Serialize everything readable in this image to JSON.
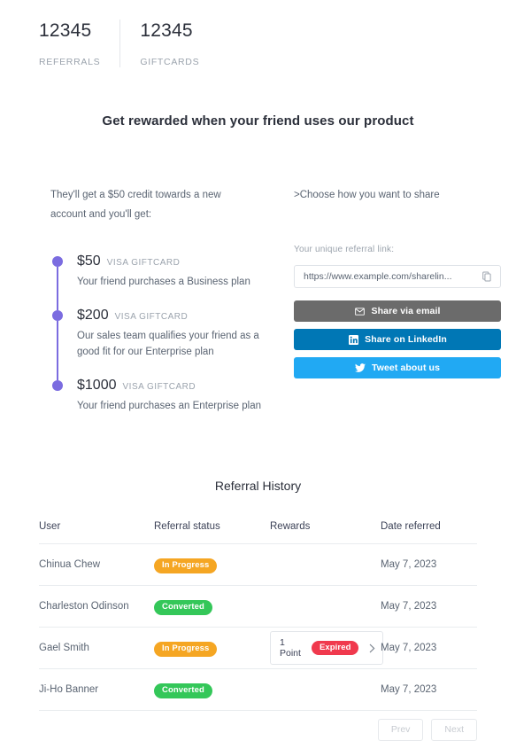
{
  "header": {
    "stats": [
      {
        "value": "12345",
        "label": "REFERRALS",
        "name": "referrals"
      },
      {
        "value": "12345",
        "label": "GIFTCARDS",
        "name": "giftcards"
      }
    ]
  },
  "hero": {
    "title": "Get rewarded when your friend uses our product",
    "intro": "They'll get a $50 credit towards a new account and you'll get:"
  },
  "timeline": {
    "items": [
      {
        "amount": "$50",
        "kind": "VISA GIFTCARD",
        "desc": "Your friend purchases a Business plan"
      },
      {
        "amount": "$200",
        "kind": "VISA GIFTCARD",
        "desc": "Our sales team qualifies your friend as a good fit for our Enterprise plan"
      },
      {
        "amount": "$1000",
        "kind": "VISA GIFTCARD",
        "desc": "Your friend purchases an Enterprise plan"
      }
    ],
    "dot_color": "#7b6ce0"
  },
  "share": {
    "heading": ">Choose how you want to share",
    "link_label": "Your unique referral link:",
    "link_value": "https://www.example.com/sharelin...",
    "copy_icon": "copy-icon",
    "buttons": [
      {
        "label": "Share via email",
        "icon": "envelope-icon",
        "color": "#6b6b6b",
        "name": "share-email"
      },
      {
        "label": "Share on LinkedIn",
        "icon": "linkedin-icon",
        "color": "#0077b5",
        "name": "share-linkedin"
      },
      {
        "label": "Tweet about us",
        "icon": "twitter-icon",
        "color": "#21a9f3",
        "name": "share-twitter"
      }
    ]
  },
  "history": {
    "title": "Referral History",
    "columns": [
      "User",
      "Referral status",
      "Rewards",
      "Date referred"
    ],
    "rows": [
      {
        "user": "Chinua Chew",
        "status": "In Progress",
        "status_type": "progress",
        "reward": null,
        "date": "May 7, 2023"
      },
      {
        "user": "Charleston Odinson",
        "status": "Converted",
        "status_type": "converted",
        "reward": null,
        "date": "May 7, 2023"
      },
      {
        "user": "Gael Smith",
        "status": "In Progress",
        "status_type": "progress",
        "reward": {
          "points": "1 Point",
          "badge": "Expired"
        },
        "date": "May 7, 2023"
      },
      {
        "user": "Ji-Ho Banner",
        "status": "Converted",
        "status_type": "converted",
        "reward": null,
        "date": "May 7, 2023"
      }
    ],
    "pagination": {
      "prev": "Prev",
      "next": "Next"
    }
  },
  "colors": {
    "purple": "#7b6ce0",
    "orange": "#f5a623",
    "green": "#34c759",
    "red": "#f0394d",
    "linkedin": "#0077b5",
    "twitter": "#21a9f3",
    "email": "#6b6b6b"
  }
}
